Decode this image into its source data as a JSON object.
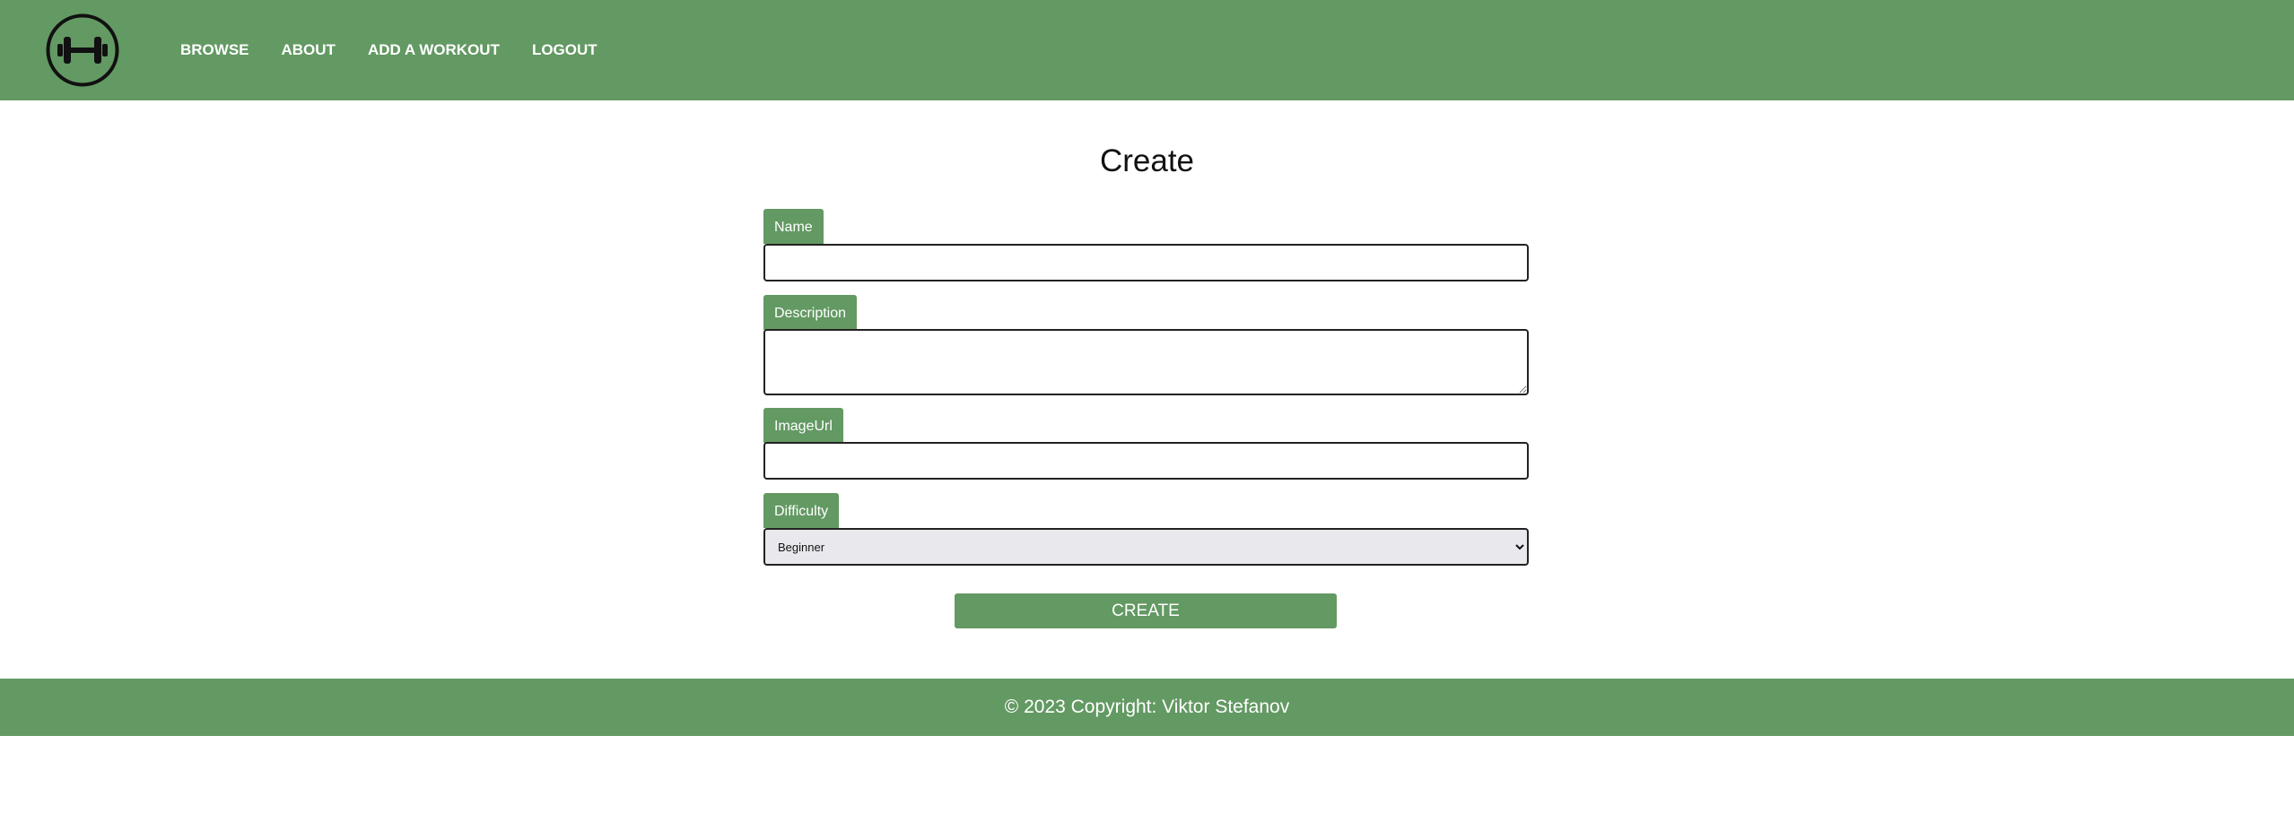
{
  "nav": {
    "logo_icon": "dumbbell-icon",
    "links": [
      {
        "label": "BROWSE"
      },
      {
        "label": "ABOUT"
      },
      {
        "label": "ADD A WORKOUT"
      },
      {
        "label": "LOGOUT"
      }
    ]
  },
  "form": {
    "title": "Create",
    "fields": {
      "name": {
        "label": "Name",
        "value": ""
      },
      "description": {
        "label": "Description",
        "value": ""
      },
      "image_url": {
        "label": "ImageUrl",
        "value": ""
      },
      "difficulty": {
        "label": "Difficulty",
        "selected": "Beginner"
      }
    },
    "submit_label": "CREATE"
  },
  "footer": {
    "text": "© 2023 Copyright: Viktor Stefanov"
  },
  "colors": {
    "brand_green": "#639963",
    "select_bg": "#e9e8ed"
  }
}
